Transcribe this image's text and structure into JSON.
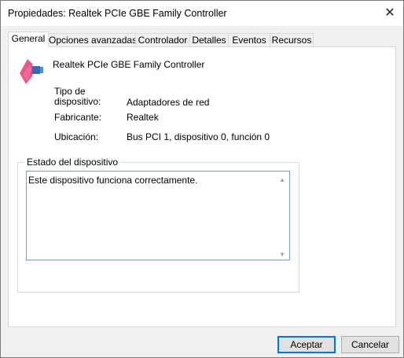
{
  "window": {
    "title": "Propiedades: Realtek PCIe GBE Family Controller",
    "close_glyph": "✕"
  },
  "tabs": [
    {
      "label": "General",
      "active": true
    },
    {
      "label": "Opciones avanzadas",
      "active": false
    },
    {
      "label": "Controlador",
      "active": false
    },
    {
      "label": "Detalles",
      "active": false
    },
    {
      "label": "Eventos",
      "active": false
    },
    {
      "label": "Recursos",
      "active": false
    }
  ],
  "general": {
    "device_icon": "network-adapter-icon",
    "device_name": "Realtek PCIe GBE Family Controller",
    "fields": [
      {
        "label": "Tipo de dispositivo:",
        "value": "Adaptadores de red"
      },
      {
        "label": "Fabricante:",
        "value": "Realtek"
      },
      {
        "label": "Ubicación:",
        "value": "Bus PCI 1, dispositivo 0, función 0"
      }
    ],
    "status_group_label": "Estado del dispositivo",
    "status_text": "Este dispositivo funciona correctamente."
  },
  "buttons": {
    "accept_label": "Aceptar",
    "cancel_label": "Cancelar"
  },
  "colors": {
    "accent": "#0078d7",
    "icon_arrow": "#e8467c"
  }
}
